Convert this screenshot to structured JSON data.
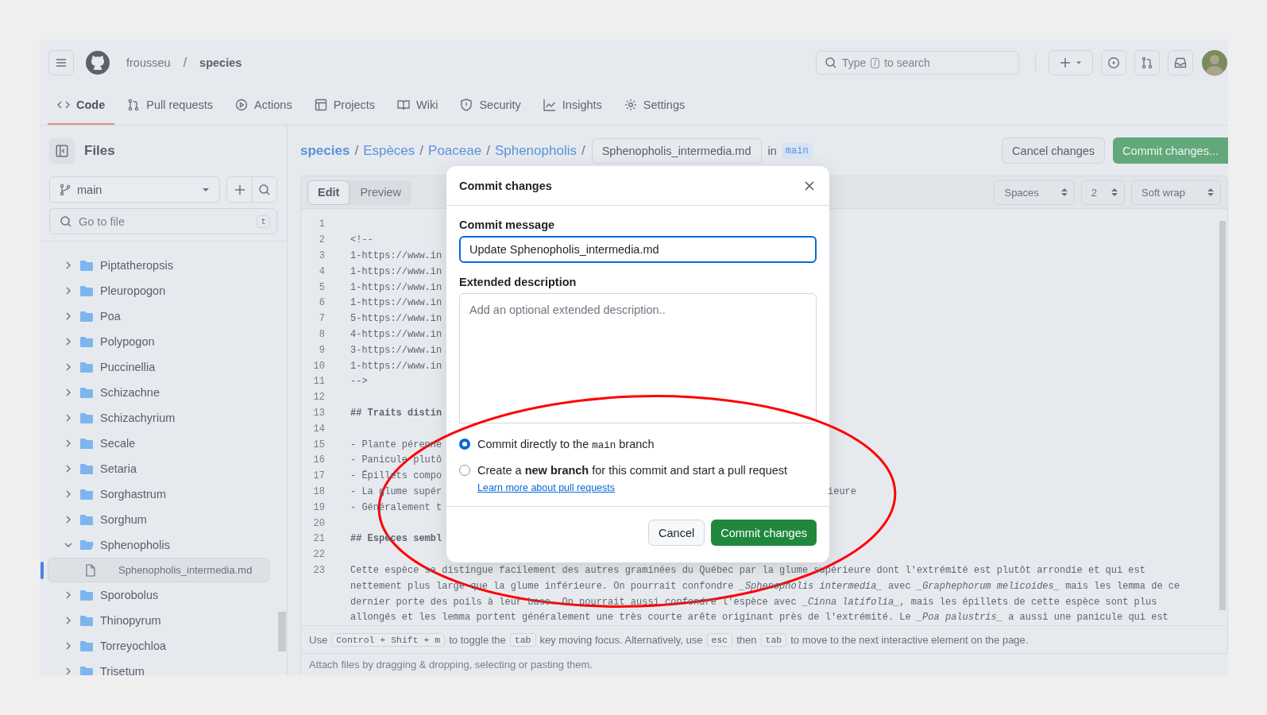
{
  "header": {
    "owner": "frousseu",
    "separator": "/",
    "repo": "species",
    "search": {
      "before": "Type",
      "key": "/",
      "after": "to search"
    }
  },
  "nav_tabs": [
    {
      "label": "Code",
      "selected": true
    },
    {
      "label": "Pull requests",
      "selected": false
    },
    {
      "label": "Actions",
      "selected": false
    },
    {
      "label": "Projects",
      "selected": false
    },
    {
      "label": "Wiki",
      "selected": false
    },
    {
      "label": "Security",
      "selected": false
    },
    {
      "label": "Insights",
      "selected": false
    },
    {
      "label": "Settings",
      "selected": false
    }
  ],
  "sidebar": {
    "title": "Files",
    "branch": "main",
    "go_to_file": {
      "placeholder": "Go to file",
      "shortcut": "t"
    },
    "tree": [
      {
        "name": "Piptatheropsis",
        "kind": "folder",
        "expanded": false,
        "selected": false
      },
      {
        "name": "Pleuropogon",
        "kind": "folder",
        "expanded": false,
        "selected": false
      },
      {
        "name": "Poa",
        "kind": "folder",
        "expanded": false,
        "selected": false
      },
      {
        "name": "Polypogon",
        "kind": "folder",
        "expanded": false,
        "selected": false
      },
      {
        "name": "Puccinellia",
        "kind": "folder",
        "expanded": false,
        "selected": false
      },
      {
        "name": "Schizachne",
        "kind": "folder",
        "expanded": false,
        "selected": false
      },
      {
        "name": "Schizachyrium",
        "kind": "folder",
        "expanded": false,
        "selected": false
      },
      {
        "name": "Secale",
        "kind": "folder",
        "expanded": false,
        "selected": false
      },
      {
        "name": "Setaria",
        "kind": "folder",
        "expanded": false,
        "selected": false
      },
      {
        "name": "Sorghastrum",
        "kind": "folder",
        "expanded": false,
        "selected": false
      },
      {
        "name": "Sorghum",
        "kind": "folder",
        "expanded": false,
        "selected": false
      },
      {
        "name": "Sphenopholis",
        "kind": "folder",
        "expanded": true,
        "selected": false,
        "children": [
          {
            "name": "Sphenopholis_intermedia.md",
            "kind": "file",
            "selected": true
          }
        ]
      },
      {
        "name": "Sporobolus",
        "kind": "folder",
        "expanded": false,
        "selected": false
      },
      {
        "name": "Thinopyrum",
        "kind": "folder",
        "expanded": false,
        "selected": false
      },
      {
        "name": "Torreyochloa",
        "kind": "folder",
        "expanded": false,
        "selected": false
      },
      {
        "name": "Trisetum",
        "kind": "folder",
        "expanded": false,
        "selected": false
      }
    ]
  },
  "breadcrumb": {
    "parts": [
      {
        "label": "species",
        "separator": "/"
      },
      {
        "label": "Espèces",
        "separator": "/"
      },
      {
        "label": "Poaceae",
        "separator": "/"
      },
      {
        "label": "Sphenopholis",
        "separator": "/"
      }
    ],
    "file_name": "Sphenopholis_intermedia.md",
    "in_label": "in",
    "branch": "main"
  },
  "actions": {
    "cancel": "Cancel changes",
    "commit": "Commit changes..."
  },
  "editor": {
    "mode_tabs": [
      {
        "label": "Edit",
        "selected": true
      },
      {
        "label": "Preview",
        "selected": false
      }
    ],
    "indent_mode": "Spaces",
    "indent_size": "2",
    "wrap_mode": "Soft wrap",
    "lines": [
      {
        "number": "1"
      },
      {
        "number": "2",
        "kind": "text",
        "text": "<!--"
      },
      {
        "number": "3",
        "kind": "text",
        "text": "1-https://www.in"
      },
      {
        "number": "4",
        "kind": "text",
        "text": "1-https://www.in"
      },
      {
        "number": "5",
        "kind": "text",
        "text": "1-https://www.in"
      },
      {
        "number": "6",
        "kind": "text",
        "text": "1-https://www.in"
      },
      {
        "number": "7",
        "kind": "text",
        "text": "5-https://www.in"
      },
      {
        "number": "8",
        "kind": "text",
        "text": "4-https://www.in"
      },
      {
        "number": "9",
        "kind": "text",
        "text": "3-https://www.in"
      },
      {
        "number": "10",
        "kind": "text",
        "text": "1-https://www.in"
      },
      {
        "number": "11",
        "kind": "text",
        "text": "-->"
      },
      {
        "number": "12"
      },
      {
        "number": "13",
        "kind": "heading",
        "text": "## Traits distin"
      },
      {
        "number": "14"
      },
      {
        "number": "15",
        "kind": "text",
        "text": "- Plante pérenne"
      },
      {
        "number": "16",
        "kind": "text",
        "text": "- Panicule plutô"
      },
      {
        "number": "17",
        "kind": "text",
        "text": "- Épillets compo"
      },
      {
        "number": "18",
        "kind": "text",
        "text": "- La glume supér",
        "after": "ieure"
      },
      {
        "number": "19",
        "kind": "text",
        "text": "- Généralement t"
      },
      {
        "number": "20"
      },
      {
        "number": "21",
        "kind": "heading",
        "text": "## Espèces sembl"
      },
      {
        "number": "22"
      },
      {
        "number": "23",
        "kind": "text",
        "text": "Cette espèce se distingue facilement des autres graminées du Québec par la glume supérieure dont l'extrémité est plutôt arrondie et qui est"
      },
      {
        "kind": "text",
        "text": "nettement plus large que la glume inférieure. On pourrait confondre *_Sphenopholis intermedia_* avec *_Graphephorum melicoides_* mais les lemma de ce"
      },
      {
        "kind": "text",
        "text": "dernier porte des poils à leur base. On pourrait aussi confondre l'espèce avec *_Cinna latifolia_*, mais les épillets de cette espèce sont plus"
      },
      {
        "kind": "text",
        "text": "allongés et les lemma portent généralement une très courte arête originant près de l'extrémité. Le *_Poa palustris_* a aussi une panicule qui est"
      }
    ],
    "hint": [
      {
        "kind": "text",
        "text": "Use"
      },
      {
        "kind": "key",
        "text": "Control + Shift + m"
      },
      {
        "kind": "text",
        "text": "to toggle the"
      },
      {
        "kind": "key",
        "text": "tab"
      },
      {
        "kind": "text",
        "text": "key moving focus. Alternatively, use"
      },
      {
        "kind": "key",
        "text": "esc"
      },
      {
        "kind": "text",
        "text": "then"
      },
      {
        "kind": "key",
        "text": "tab"
      },
      {
        "kind": "text",
        "text": "to move to the next interactive element on the page."
      }
    ],
    "attach_hint": "Attach files by dragging & dropping, selecting or pasting them."
  },
  "dialog": {
    "title": "Commit changes",
    "message_label": "Commit message",
    "message_value": "Update Sphenopholis_intermedia.md",
    "description_label": "Extended description",
    "description_placeholder": "Add an optional extended description..",
    "options": [
      {
        "selected": true,
        "before": "Commit directly to the",
        "code": "main",
        "after": "branch"
      },
      {
        "selected": false,
        "text": "Create a **new branch** for this commit and start a pull request",
        "link": "Learn more about pull requests"
      }
    ],
    "cancel": "Cancel",
    "confirm": "Commit changes"
  }
}
